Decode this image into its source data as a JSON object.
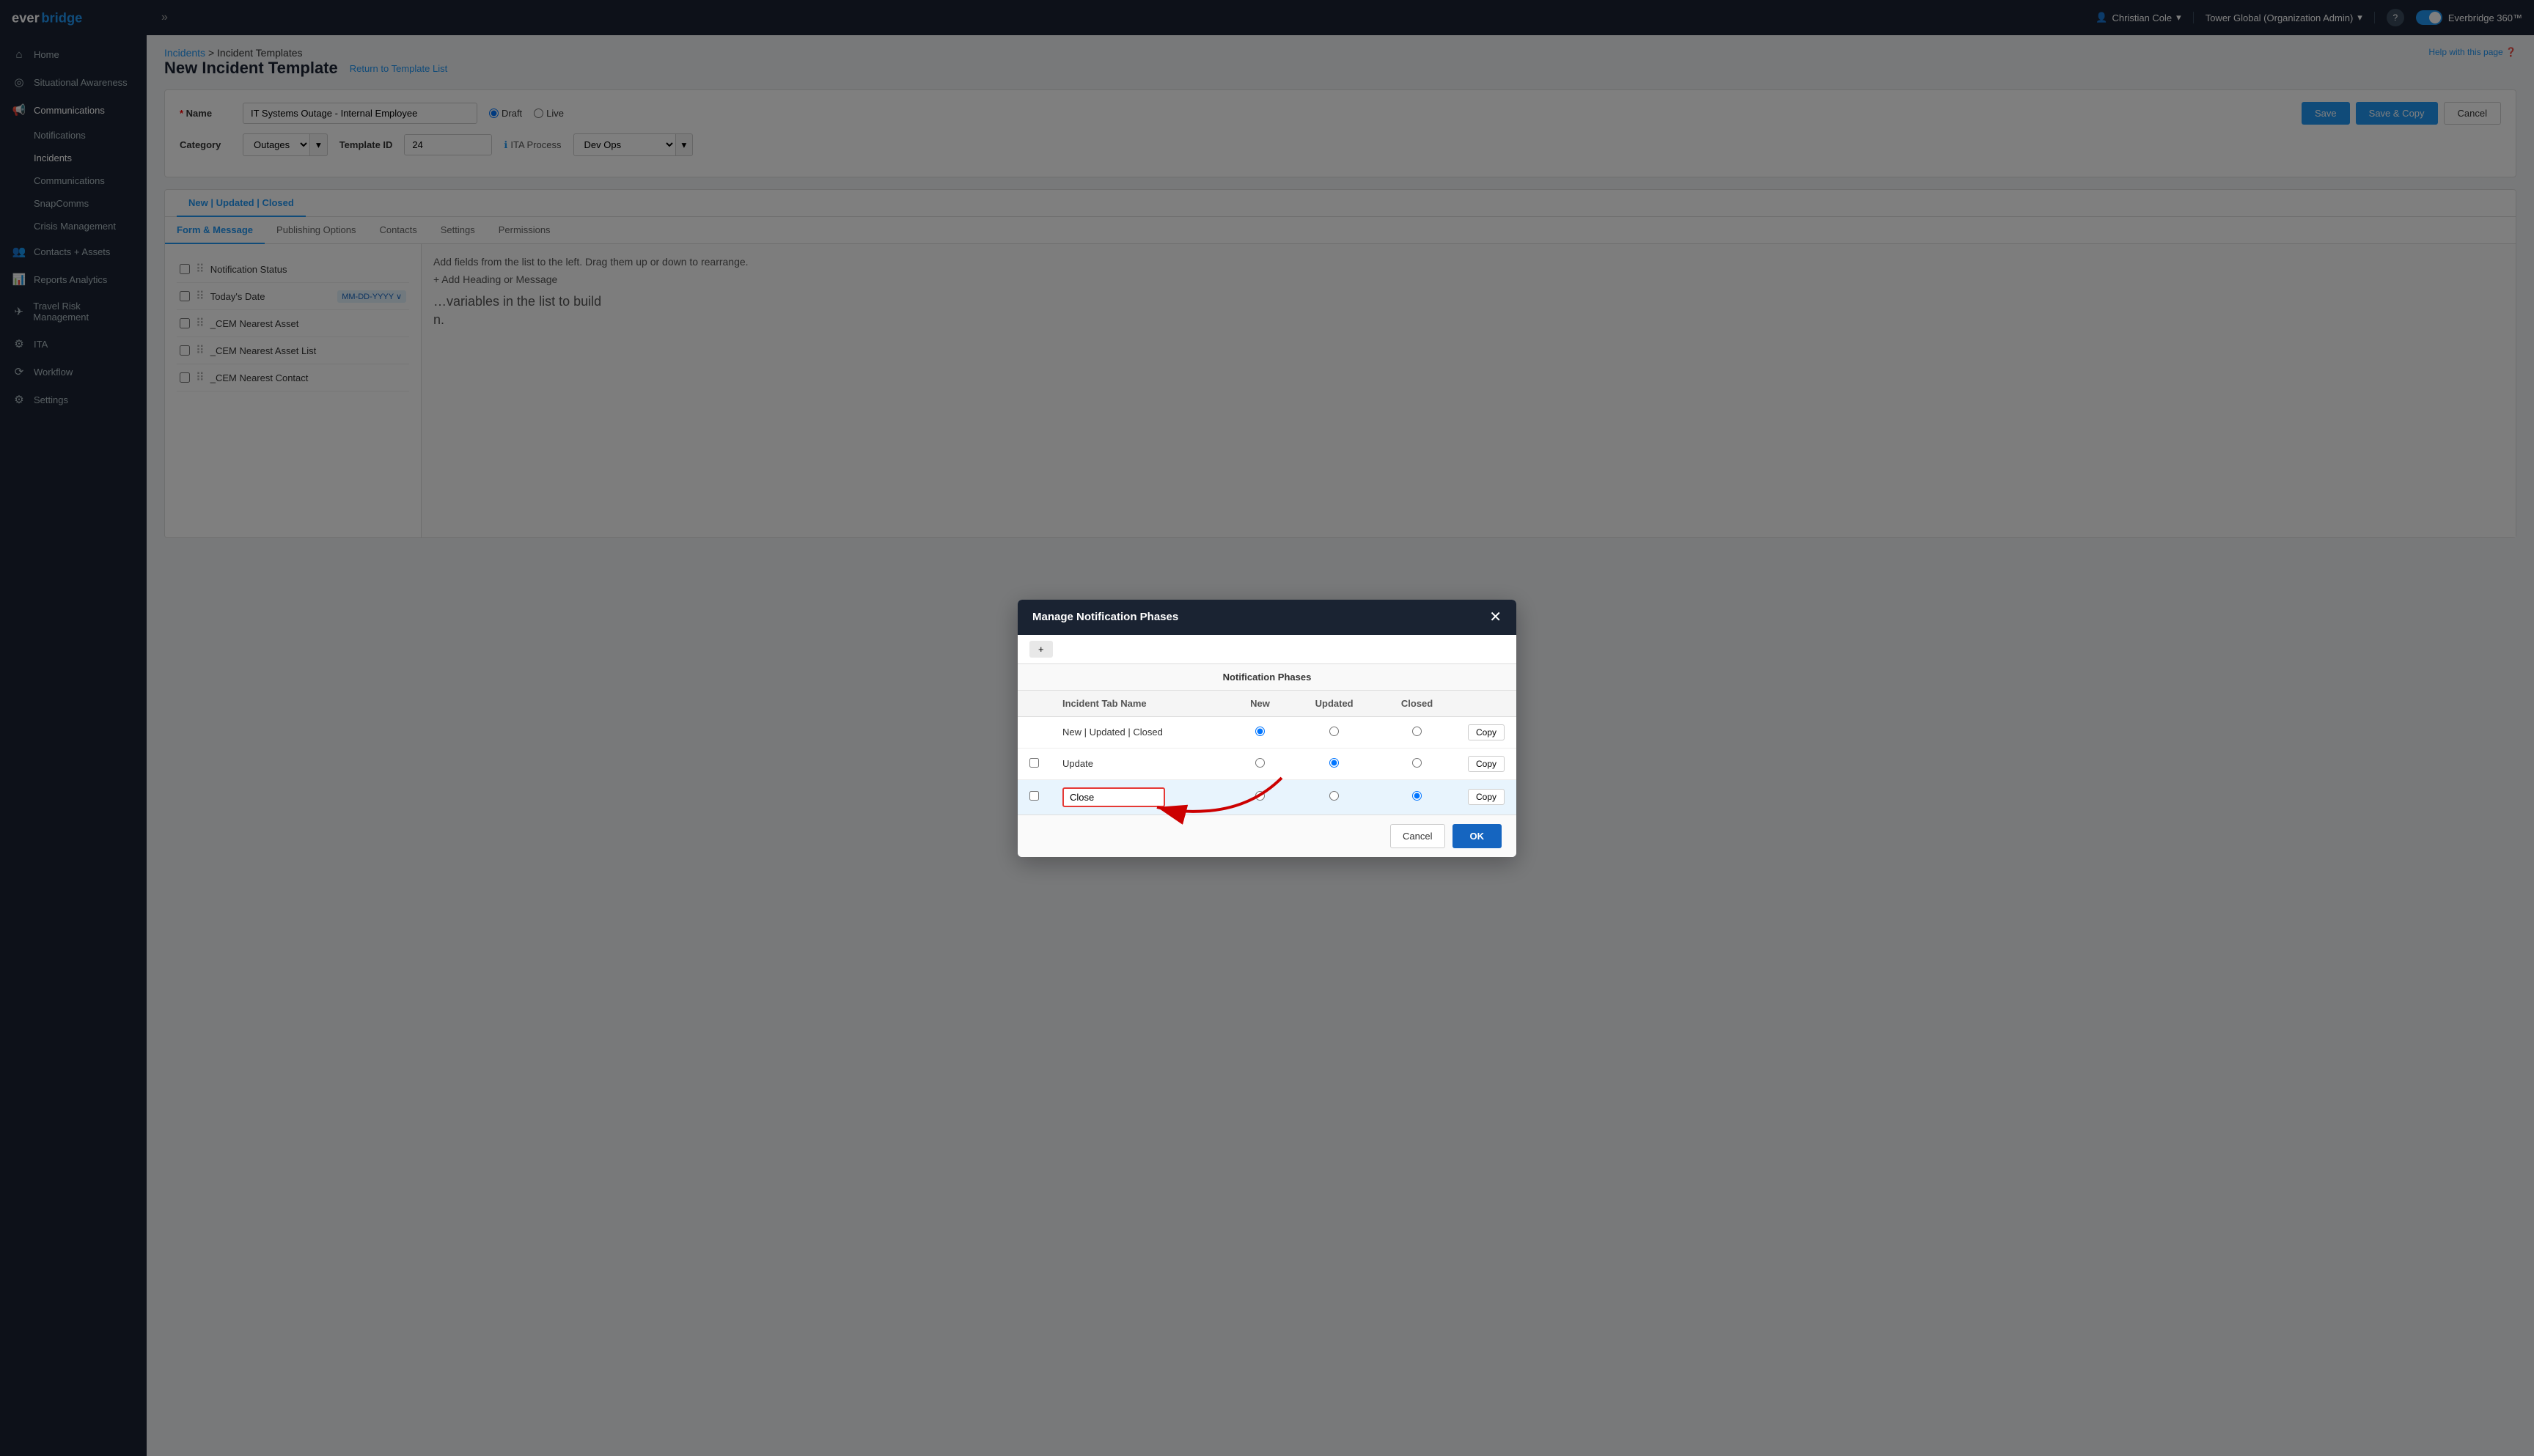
{
  "topNav": {
    "logoText": "everbridge",
    "collapseArrow": "»",
    "user": "Christian Cole",
    "org": "Tower Global (Organization Admin)",
    "helpIcon": "?",
    "toggleLabel": "Everbridge 360™"
  },
  "sidebar": {
    "items": [
      {
        "id": "home",
        "label": "Home",
        "icon": "⌂",
        "active": false
      },
      {
        "id": "situational-awareness",
        "label": "Situational Awareness",
        "icon": "◎",
        "active": false
      },
      {
        "id": "communications",
        "label": "Communications",
        "icon": "📢",
        "active": true,
        "children": [
          {
            "id": "notifications",
            "label": "Notifications"
          },
          {
            "id": "incidents",
            "label": "Incidents",
            "active": true,
            "children": [
              {
                "id": "communications-sub",
                "label": "Communications"
              },
              {
                "id": "snapcomms",
                "label": "SnapComms"
              }
            ]
          },
          {
            "id": "crisis-management",
            "label": "Crisis Management"
          }
        ]
      },
      {
        "id": "contacts-assets",
        "label": "Contacts + Assets",
        "icon": "👥",
        "active": false
      },
      {
        "id": "reports-analytics",
        "label": "Reports Analytics",
        "icon": "📊",
        "active": false
      },
      {
        "id": "travel-risk",
        "label": "Travel Risk Management",
        "icon": "✈",
        "active": false
      },
      {
        "id": "ita",
        "label": "ITA",
        "icon": "⚙",
        "active": false
      },
      {
        "id": "workflow",
        "label": "Workflow",
        "icon": "⟳",
        "active": false
      },
      {
        "id": "settings",
        "label": "Settings",
        "icon": "⚙",
        "active": false
      }
    ]
  },
  "breadcrumb": {
    "items": [
      "Incidents",
      "Incident Templates"
    ]
  },
  "helpText": "Help with this page",
  "pageTitle": "New Incident Template",
  "returnLink": "Return to Template List",
  "form": {
    "nameLabel": "Name",
    "nameValue": "IT Systems Outage - Internal Employee",
    "draftLabel": "Draft",
    "liveLabel": "Live",
    "selectedStatus": "draft",
    "categoryLabel": "Category",
    "categoryValue": "Outages",
    "templateIdLabel": "Template ID",
    "templateIdValue": "24",
    "itaProcessLabel": "ITA Process",
    "itaProcessValue": "Dev Ops",
    "saveLabel": "Save",
    "saveCopyLabel": "Save & Copy",
    "cancelLabel": "Cancel"
  },
  "tabs": {
    "tabNew": "New",
    "tabUpdated": "Updated",
    "tabClosed": "Closed",
    "separator": "|",
    "subTabs": [
      {
        "id": "form-message",
        "label": "Form & Message",
        "active": true
      },
      {
        "id": "publishing-options",
        "label": "Publishing Options"
      },
      {
        "id": "contacts",
        "label": "Contacts"
      },
      {
        "id": "settings",
        "label": "Settings"
      },
      {
        "id": "permissions",
        "label": "Permissions"
      }
    ]
  },
  "leftPanel": {
    "hint": "Add fields from the list to the left. Drag them up or down to rearrange.",
    "addLabel": "+ Add Heading or Message",
    "fields": [
      {
        "id": "notification-status",
        "label": "Notification Status",
        "checked": false
      },
      {
        "id": "todays-date",
        "label": "Today's Date",
        "badge": "MM-DD-YYYY ∨",
        "checked": false
      },
      {
        "id": "cem-nearest-asset",
        "label": "_CEM Nearest Asset",
        "checked": false
      },
      {
        "id": "cem-nearest-asset-list",
        "label": "_CEM Nearest Asset List",
        "checked": false
      },
      {
        "id": "cem-nearest-contact",
        "label": "_CEM Nearest Contact",
        "checked": false
      }
    ]
  },
  "rightPanel": {
    "hintLine1": "variables in the list to build",
    "hintLine2": "n."
  },
  "modal": {
    "title": "Manage Notification Phases",
    "closeIcon": "✕",
    "addTabLabel": "+",
    "phasesTitle": "Notification Phases",
    "tableHeaders": {
      "tabName": "Incident Tab Name",
      "new": "New",
      "updated": "Updated",
      "closed": "Closed"
    },
    "rows": [
      {
        "id": "new-updated-closed",
        "name": "New | Updated | Closed",
        "newSelected": true,
        "updatedSelected": false,
        "closedSelected": false,
        "copyLabel": "Copy",
        "editable": false
      },
      {
        "id": "update",
        "name": "Update",
        "newSelected": false,
        "updatedSelected": true,
        "closedSelected": false,
        "copyLabel": "Copy",
        "editable": false,
        "checkable": true
      },
      {
        "id": "close",
        "name": "Close",
        "nameInputValue": "Close",
        "newSelected": false,
        "updatedSelected": false,
        "closedSelected": true,
        "copyLabel": "Copy",
        "editable": true,
        "checkable": true,
        "highlighted": true
      }
    ],
    "cancelLabel": "Cancel",
    "okLabel": "OK"
  }
}
